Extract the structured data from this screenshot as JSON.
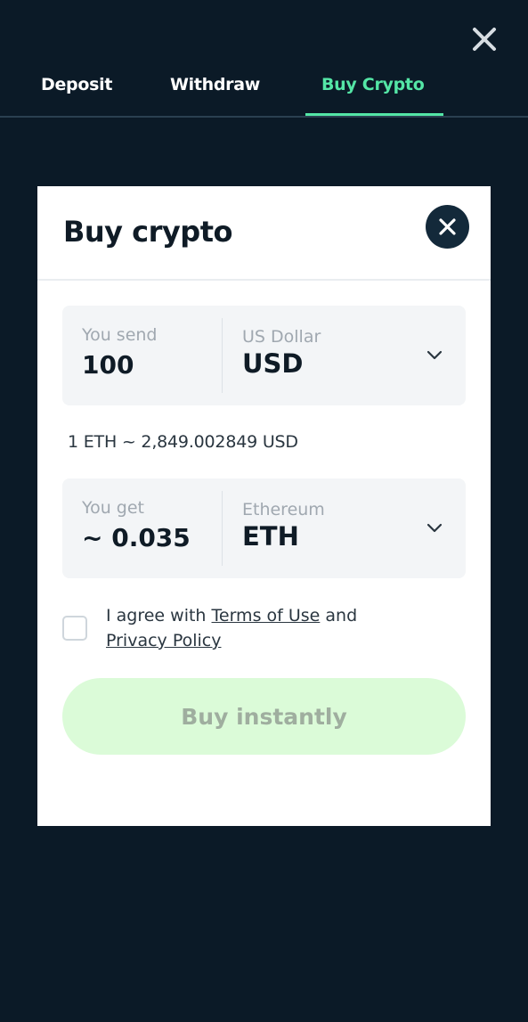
{
  "header": {
    "close_icon": "close-icon"
  },
  "tabs": [
    {
      "label": "Deposit",
      "active": false
    },
    {
      "label": "Withdraw",
      "active": false
    },
    {
      "label": "Buy Crypto",
      "active": true
    }
  ],
  "colors": {
    "background": "#0b1a27",
    "accent": "#54e6a6",
    "card": "#ffffff",
    "button_disabled_bg": "#dbfbd8",
    "button_disabled_text": "#9fae9f"
  },
  "modal": {
    "title": "Buy crypto",
    "close_icon": "close-icon",
    "send": {
      "label": "You send",
      "value": "100",
      "currency_name": "US Dollar",
      "currency_code": "USD",
      "dropdown_icon": "chevron-down-icon"
    },
    "rate": "1 ETH ~ 2,849.002849 USD",
    "get": {
      "label": "You get",
      "value": "~ 0.035",
      "currency_name": "Ethereum",
      "currency_code": "ETH",
      "dropdown_icon": "chevron-down-icon"
    },
    "agreement": {
      "prefix": "I agree with ",
      "terms_link": "Terms of Use",
      "middle": " and",
      "privacy_link": "Privacy Policy",
      "checked": false
    },
    "buy_button": "Buy instantly"
  }
}
